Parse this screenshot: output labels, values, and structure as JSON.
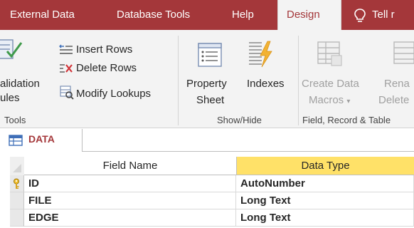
{
  "tabs": {
    "external_data": "External Data",
    "database_tools": "Database Tools",
    "help": "Help",
    "design": "Design",
    "tell_me": "Tell r"
  },
  "ribbon": {
    "tools": {
      "validation_line1": "alidation",
      "validation_line2": "ules",
      "insert_rows": "Insert Rows",
      "delete_rows": "Delete Rows",
      "modify_lookups": "Modify Lookups",
      "group_label": "Tools"
    },
    "show_hide": {
      "property_sheet_line1": "Property",
      "property_sheet_line2": "Sheet",
      "indexes": "Indexes",
      "group_label": "Show/Hide"
    },
    "field_record_table": {
      "create_data_macros_line1": "Create Data",
      "create_data_macros_line2": "Macros",
      "rename_delete_line1": "Rena",
      "rename_delete_line2": "Delete",
      "group_label": "Field, Record & Table"
    }
  },
  "object_tab": {
    "label": "DATA"
  },
  "grid": {
    "headers": {
      "field_name": "Field Name",
      "data_type": "Data Type"
    },
    "rows": [
      {
        "field_name": "ID",
        "data_type": "AutoNumber",
        "primary_key": true
      },
      {
        "field_name": "FILE",
        "data_type": "Long Text",
        "primary_key": false
      },
      {
        "field_name": "EDGE",
        "data_type": "Long Text",
        "primary_key": false
      }
    ]
  },
  "colors": {
    "accent": "#a4373a",
    "ribbon_bg": "#f3f3f3",
    "data_type_header": "#ffe168"
  }
}
